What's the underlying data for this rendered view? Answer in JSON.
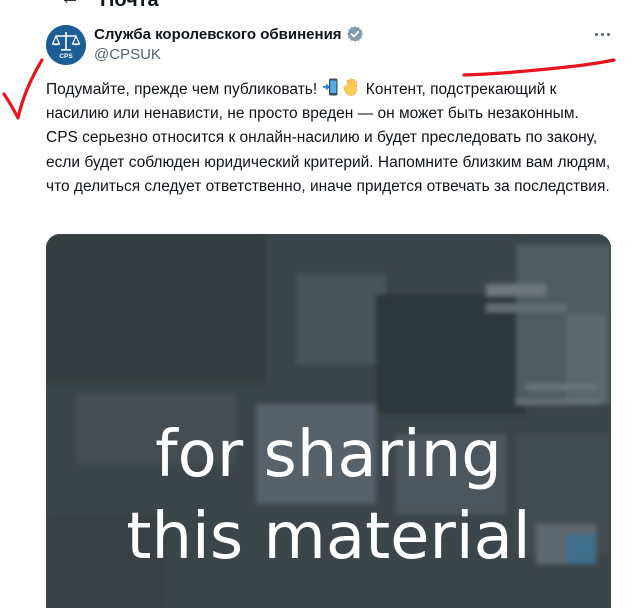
{
  "page": {
    "title_partial": "Почта"
  },
  "account": {
    "name": "Служба королевского обвинения",
    "handle": "@CPSUK",
    "avatar_text": "CPS"
  },
  "post": {
    "text_part1": "Подумайте, прежде чем публиковать! ",
    "emoji_icons": [
      "mobile-phone-arrow-icon",
      "raised-hand-icon"
    ],
    "text_part2": " Контент, подстрекающий к насилию или ненависти, не просто вреден — он может быть незаконным. CPS серьезно относится к онлайн-насилию и будет преследовать по закону, если будет соблюден юридический критерий. Напомните близким вам людям, что делиться следует ответственно, иначе придется отвечать за последствия."
  },
  "media": {
    "caption_line1": "for sharing",
    "caption_line2": "this material"
  },
  "colors": {
    "text": "#0f1419",
    "secondary": "#536471",
    "verified": "#829aab",
    "annotation_red": "#e8141d",
    "avatar_bg": "#1d5d95"
  }
}
